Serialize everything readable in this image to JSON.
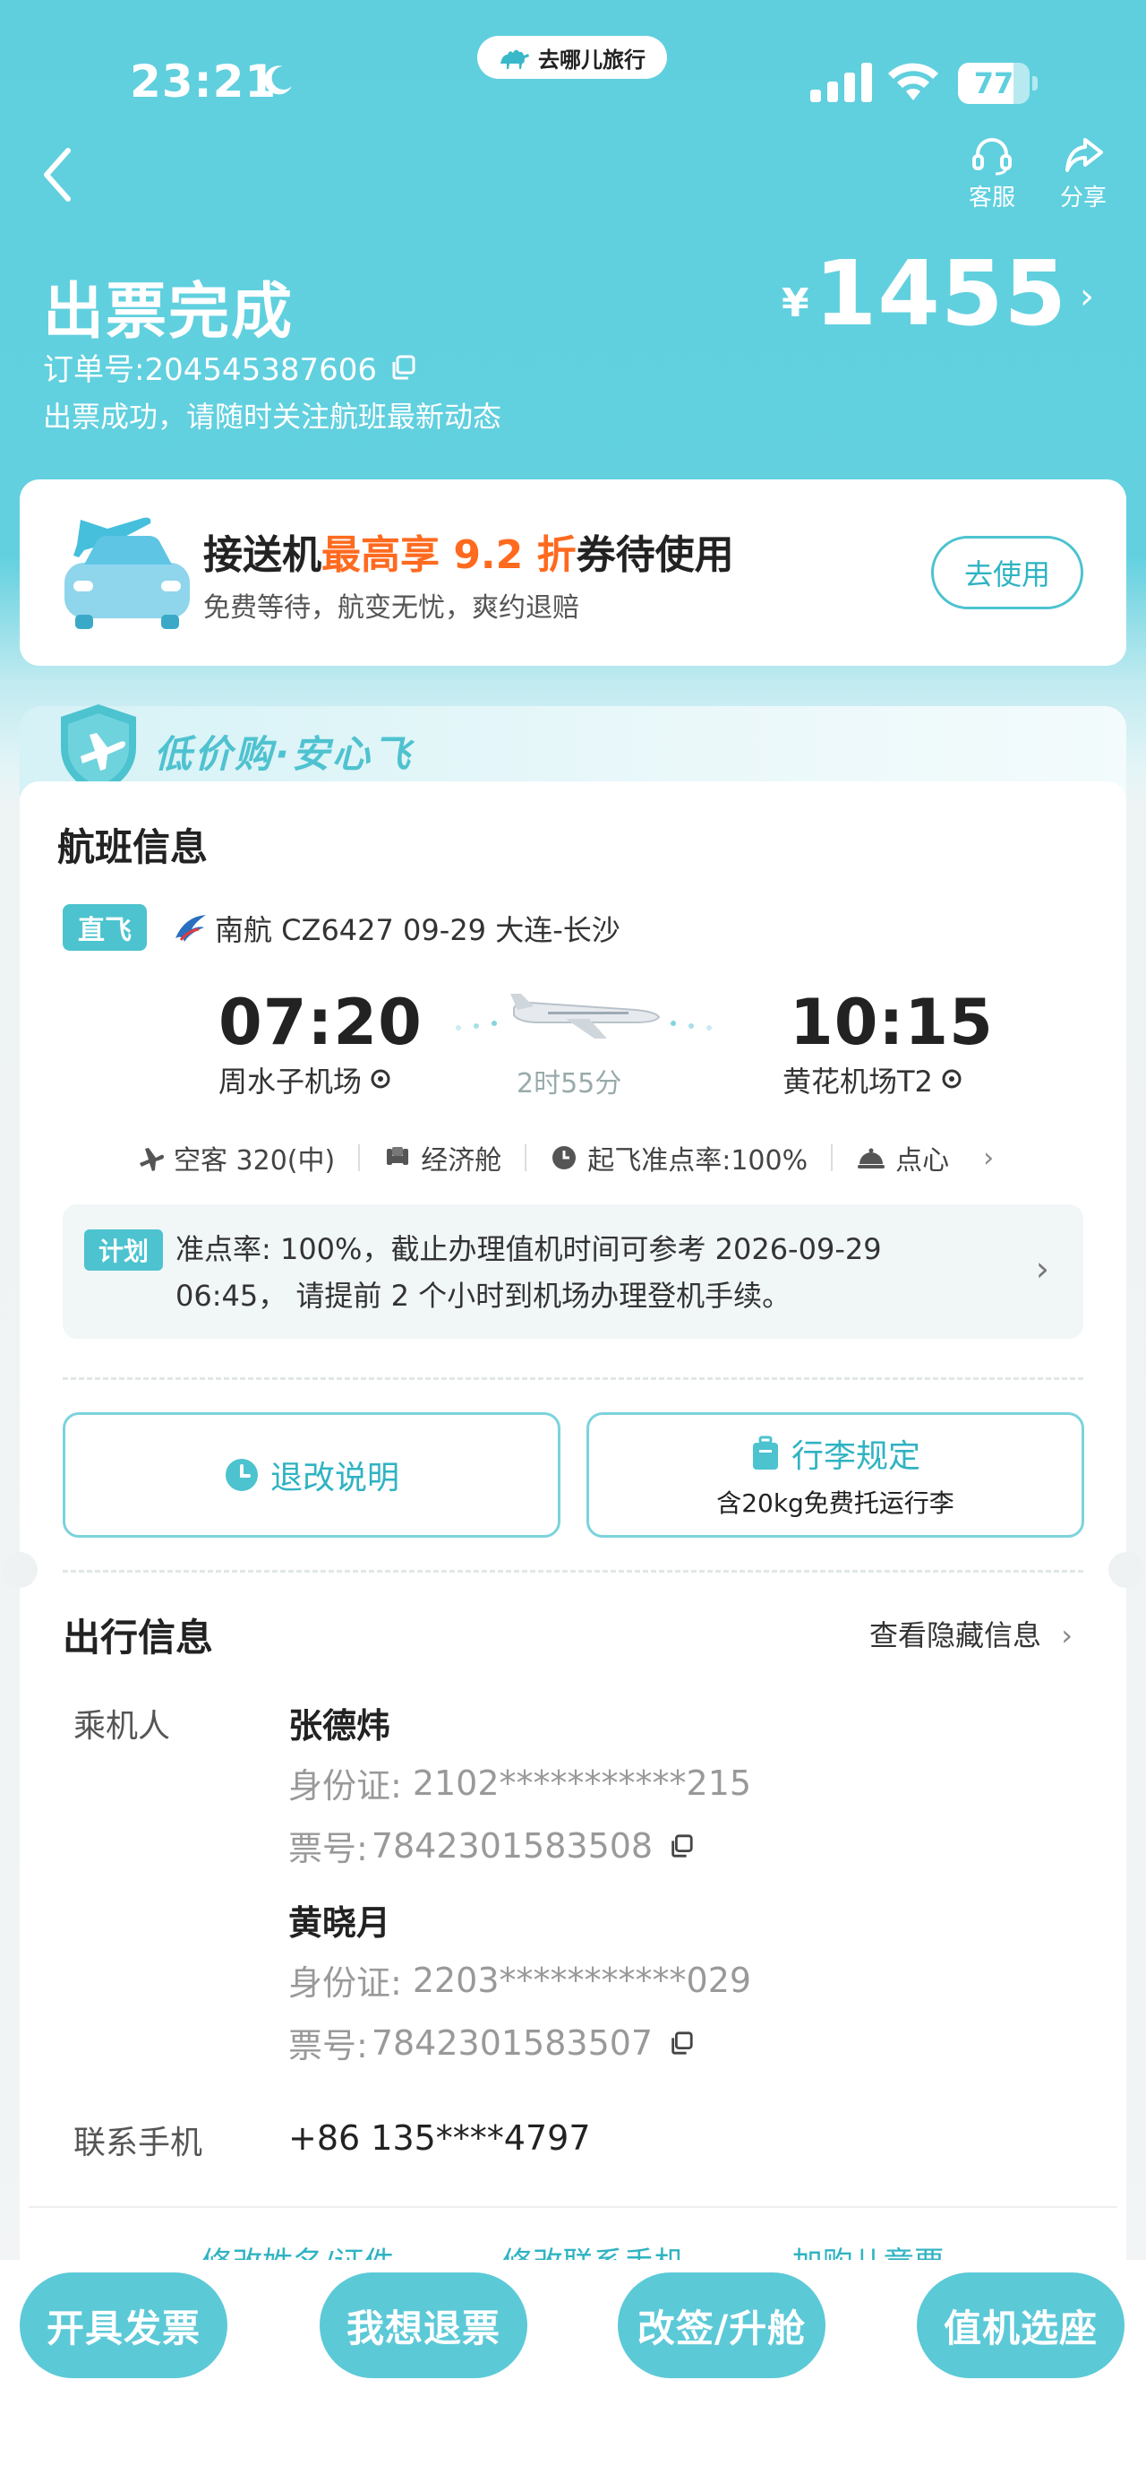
{
  "status_bar": {
    "time": "23:21",
    "app_name": "去哪儿旅行",
    "battery": "77",
    "battery_level_percent": 77
  },
  "nav": {
    "service_label": "客服",
    "share_label": "分享"
  },
  "header": {
    "title": "出票完成",
    "order_number": "订单号:204545387606",
    "subtitle": "出票成功，请随时关注航班最新动态",
    "currency": "¥",
    "price": "1455"
  },
  "promo": {
    "title_prefix": "接送机",
    "title_highlight": "最高享 9.2 折",
    "title_suffix": "券待使用",
    "subtitle": "免费等待，航变无忧，爽约退赔",
    "button": "去使用"
  },
  "banner": {
    "text": "低价购·安心飞"
  },
  "flight": {
    "section_title": "航班信息",
    "tag": "直飞",
    "airline_line": "南航 CZ6427   09-29 大连-长沙",
    "dep_time": "07:20",
    "dep_airport": "周水子机场",
    "arr_time": "10:15",
    "arr_airport": "黄花机场T2",
    "duration": "2时55分",
    "amenities": {
      "aircraft": "空客 320(中)",
      "cabin": "经济舱",
      "ontime": "起飞准点率:100%",
      "meal": "点心"
    },
    "notice_tag": "计划",
    "notice_text": "准点率: 100%，截止办理值机时间可参考 2026-09-29 06:45， 请提前 2 个小时到机场办理登机手续。",
    "refund_btn": "退改说明",
    "baggage_btn": "行李规定",
    "baggage_sub": "含20kg免费托运行李"
  },
  "travel": {
    "section_title": "出行信息",
    "view_hidden": "查看隐藏信息",
    "passenger_label": "乘机人",
    "passengers": [
      {
        "name": "张德炜",
        "id_label": "身份证:",
        "id": "2102***********215",
        "ticket_label": "票号:",
        "ticket": "7842301583508"
      },
      {
        "name": "黄晓月",
        "id_label": "身份证:",
        "id": "2203***********029",
        "ticket_label": "票号:",
        "ticket": "7842301583507"
      }
    ],
    "contact_label": "联系手机",
    "phone": "+86 135****4797",
    "links": [
      "修改姓名/证件",
      "修改联系手机",
      "加购儿童票"
    ]
  },
  "bottom_bar": {
    "invoice": "开具发票",
    "refund": "我想退票",
    "change": "改签/升舱",
    "checkin": "值机选座"
  },
  "colors": {
    "brand": "#5fcfde",
    "accent_orange": "#ff6a1f",
    "button_teal": "#5cc9d7"
  }
}
